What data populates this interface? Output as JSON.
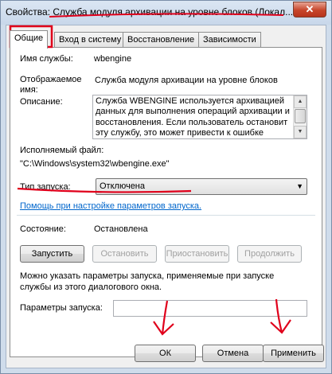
{
  "window": {
    "title": "Свойства: Служба модуля архивации на уровне блоков (Локал...",
    "close_label": "✕"
  },
  "tabs": [
    {
      "label": "Общие"
    },
    {
      "label": "Вход в систему"
    },
    {
      "label": "Восстановление"
    },
    {
      "label": "Зависимости"
    }
  ],
  "general": {
    "service_name_label": "Имя службы:",
    "service_name_value": "wbengine",
    "display_name_label": "Отображаемое имя:",
    "display_name_value": "Служба модуля архивации на уровне блоков",
    "description_label": "Описание:",
    "description_value": "Служба WBENGINE используется архивацией данных для выполнения операций архивации и восстановления. Если пользователь остановит эту службу, это может привести к ошибке",
    "exe_label": "Исполняемый файл:",
    "exe_value": "\"C:\\Windows\\system32\\wbengine.exe\"",
    "startup_type_label": "Тип запуска:",
    "startup_type_value": "Отключена",
    "help_link": "Помощь при настройке параметров запуска.",
    "status_label": "Состояние:",
    "status_value": "Остановлена",
    "buttons": {
      "start": "Запустить",
      "stop": "Остановить",
      "pause": "Приостановить",
      "resume": "Продолжить"
    },
    "hint": "Можно указать параметры запуска, применяемые при запуске службы из этого диалогового окна.",
    "params_label": "Параметры запуска:",
    "params_value": ""
  },
  "footer": {
    "ok": "ОК",
    "cancel": "Отмена",
    "apply": "Применить"
  },
  "colors": {
    "annotation": "#e0001b",
    "link": "#0066cc"
  }
}
